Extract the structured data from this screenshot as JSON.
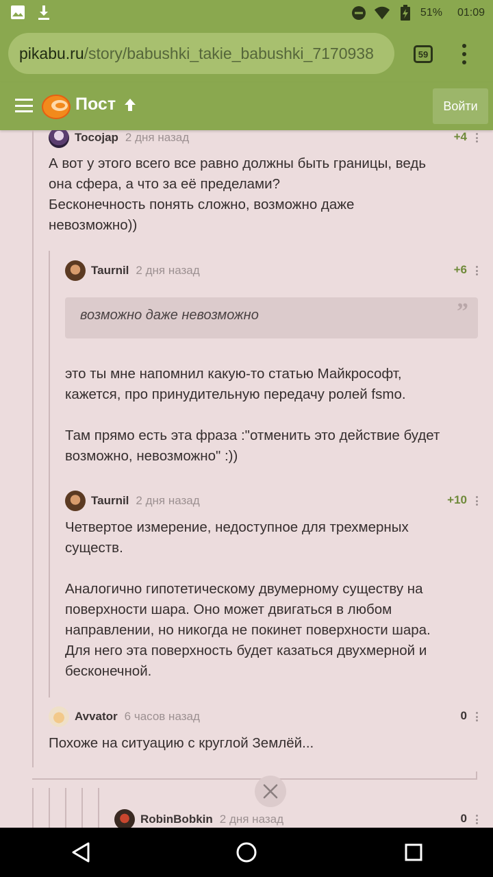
{
  "status_bar": {
    "battery": "51%",
    "time": "01:09",
    "icons": [
      "image-icon",
      "download-icon",
      "dnd-icon",
      "wifi-icon",
      "battery-icon"
    ]
  },
  "browser": {
    "url_host": "pikabu.ru",
    "url_path": "/story/babushki_takie_babushki_7170938",
    "tab_count": "59"
  },
  "header": {
    "title": "Пост",
    "login_label": "Войти",
    "colors": {
      "bar": "#8aa84f",
      "page": "#ecdcdd"
    }
  },
  "comments": [
    {
      "author": "Tocojap",
      "time": "2 дня назад",
      "rating": "+4",
      "lines": [
        "А вот у этого всего все равно должны быть границы, ведь",
        "она сфера, а что за её пределами?",
        "Бесконечность понять сложно, возможно даже",
        "невозможно))"
      ]
    },
    {
      "author": "Taurnil",
      "time": "2 дня назад",
      "rating": "+6",
      "quote": "возможно даже невозможно",
      "lines": [
        "это ты мне напомнил какую-то статью Майкрософт,",
        "кажется, про принудительную передачу ролей fsmo.",
        "",
        "Там прямо есть эта фраза :\"отменить это действие будет",
        "возможно, невозможно\" :))"
      ]
    },
    {
      "author": "Taurnil",
      "time": "2 дня назад",
      "rating": "+10",
      "lines": [
        "Четвертое измерение, недоступное для трехмерных",
        "существ.",
        "",
        "Аналогично гипотетическому двумерному существу на",
        "поверхности шара. Оно может двигаться в любом",
        "направлении, но никогда не покинет поверхности шара.",
        "Для него эта поверхность будет казаться двухмерной и",
        "бесконечной."
      ]
    },
    {
      "author": "Avvator",
      "time": "6 часов назад",
      "rating": "0",
      "lines": [
        "Похоже на ситуацию с круглой Землёй..."
      ]
    },
    {
      "author": "RobinBobkin",
      "time": "2 дня назад",
      "rating": "0",
      "lines": []
    }
  ]
}
